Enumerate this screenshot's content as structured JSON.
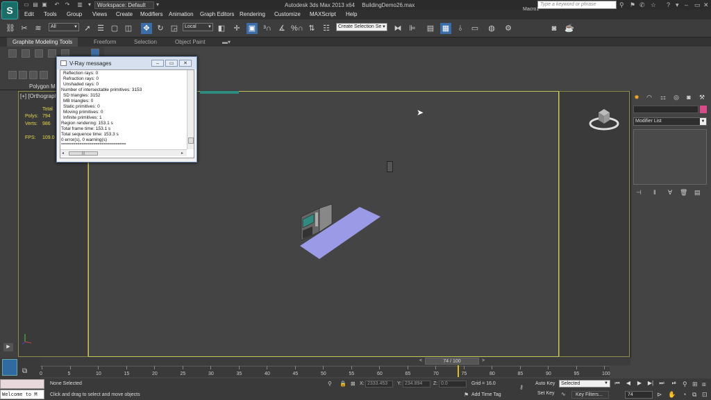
{
  "app": {
    "logo": "S",
    "title": "Autodesk 3ds Max 2013 x64",
    "file": "BuildingDemo26.max",
    "workspace": "Workspace: Default",
    "search_placeholder": "Type a keyword or phrase"
  },
  "menu": [
    "Edit",
    "Tools",
    "Group",
    "Views",
    "Create",
    "Modifiers",
    "Animation",
    "Graph Editors",
    "Rendering",
    "Customize",
    "MAXScript",
    "Help"
  ],
  "toolbar": {
    "filter": "All",
    "coord_system": "Local",
    "selection_set": "Create Selection Se",
    "macro": "Macro1"
  },
  "ribbon": {
    "tabs": [
      "Graphite Modeling Tools",
      "Freeform",
      "Selection",
      "Object Paint"
    ],
    "panel_label": "Polygon M"
  },
  "viewport": {
    "label": "[+] [Orthograph",
    "stats": {
      "total_label": "Total",
      "polys_label": "Polys:",
      "polys_value": "794",
      "verts_label": "Verts:",
      "verts_value": "986",
      "fps_label": "FPS:",
      "fps_value": "109.0"
    }
  },
  "vray": {
    "title": "V-Ray messages",
    "lines": [
      "Reflection rays: 0",
      "Refraction rays: 0",
      "Unshaded rays: 0",
      "Number of intersectable primitives: 3153",
      "SD triangles: 3152",
      "MB triangles: 0",
      "Static primitives: 0",
      "Moving primitives: 0",
      "Infinite primitives: 1",
      "Region rendering: 153.1 s",
      "Total frame time: 153.1 s",
      "Total sequence time: 153.3 s",
      "0 error(s), 0 warning(s)",
      "================================"
    ],
    "scroll_grip": "|||"
  },
  "command_panel": {
    "modifier_list": "Modifier List"
  },
  "timeline": {
    "frame_display": "74 / 100",
    "ticks": [
      "0",
      "5",
      "10",
      "15",
      "20",
      "25",
      "30",
      "35",
      "40",
      "45",
      "50",
      "55",
      "60",
      "65",
      "70",
      "75",
      "80",
      "85",
      "90",
      "95",
      "100"
    ],
    "current_frame": 74
  },
  "status": {
    "maxscript": "Welcome to M",
    "selection": "None Selected",
    "prompt": "Click and drag to select and move objects",
    "x_label": "X:",
    "x_value": "2333.453",
    "y_label": "Y:",
    "y_value": "234.894",
    "z_label": "Z:",
    "z_value": "0.0",
    "grid": "Grid = 16.0",
    "add_time_tag": "Add Time Tag",
    "auto_key": "Auto Key",
    "set_key": "Set Key",
    "selected": "Selected",
    "key_filters": "Key Filters...",
    "frame": "74"
  }
}
